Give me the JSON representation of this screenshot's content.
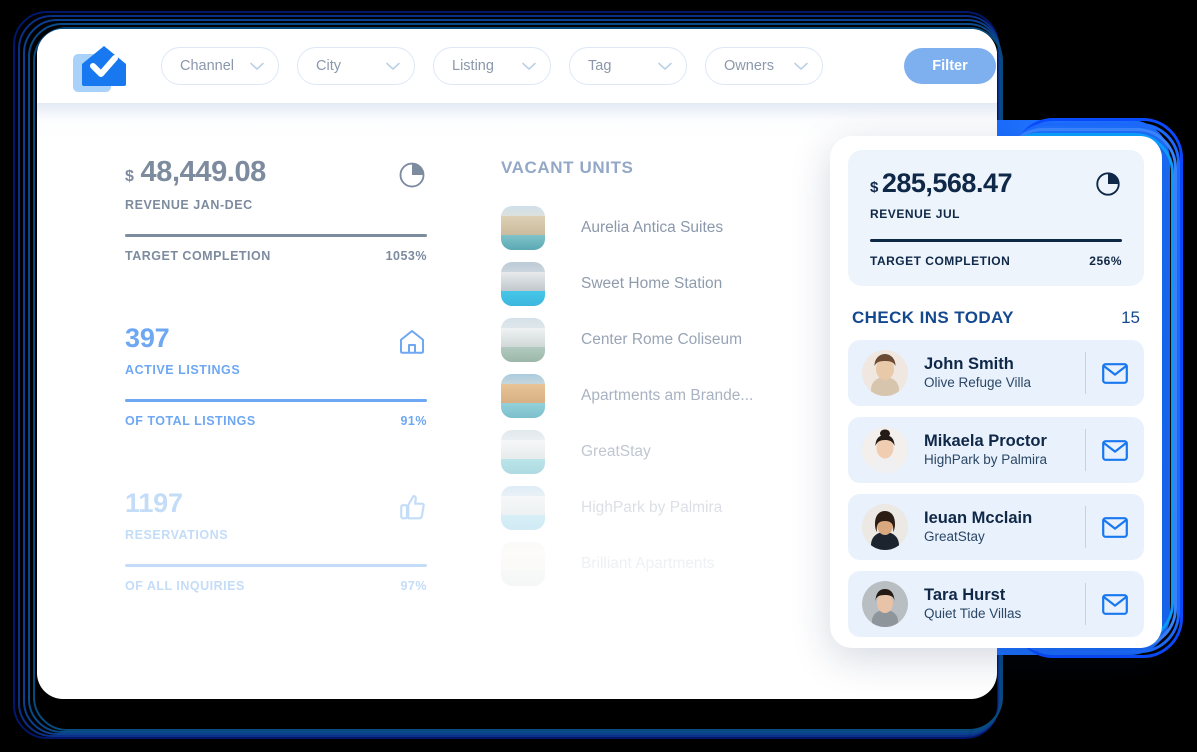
{
  "header": {
    "logo_icon": "house-check-logo",
    "filters": [
      {
        "label": "Channel",
        "icon": "chevron-down-icon"
      },
      {
        "label": "City",
        "icon": "chevron-down-icon"
      },
      {
        "label": "Listing",
        "icon": "chevron-down-icon"
      },
      {
        "label": "Tag",
        "icon": "chevron-down-icon"
      },
      {
        "label": "Owners",
        "icon": "chevron-down-icon"
      }
    ],
    "filter_button": "Filter",
    "filter_button_color": "#7eb0f0"
  },
  "stats": [
    {
      "currency": "$",
      "amount": "48,449.08",
      "caption": "REVENUE JAN-DEC",
      "foot_label": "TARGET COMPLETION",
      "foot_value": "1053%",
      "icon": "pie-chart-icon",
      "color": "#7d8b9f"
    },
    {
      "amount": "397",
      "caption": "ACTIVE LISTINGS",
      "foot_label": "OF TOTAL LISTINGS",
      "foot_value": "91%",
      "icon": "home-icon",
      "color": "#6ea7f2"
    },
    {
      "amount": "1197",
      "caption": "RESERVATIONS",
      "foot_label": "OF ALL INQUIRIES",
      "foot_value": "97%",
      "icon": "thumbs-up-icon",
      "color": "#c3dcf8"
    }
  ],
  "vacant": {
    "title": "VACANT UNITS",
    "items": [
      {
        "name": "Aurelia Antica Suites"
      },
      {
        "name": "Sweet Home Station"
      },
      {
        "name": "Center Rome Coliseum"
      },
      {
        "name": "Apartments am Brande..."
      },
      {
        "name": "GreatStay"
      },
      {
        "name": "HighPark by Palmira"
      },
      {
        "name": "Brilliant Apartments"
      }
    ]
  },
  "floating": {
    "revenue": {
      "currency": "$",
      "amount": "285,568.47",
      "caption": "REVENUE JUL",
      "foot_label": "TARGET COMPLETION",
      "foot_value": "256%",
      "icon": "pie-chart-icon",
      "accent": "#0f2847"
    },
    "checkins": {
      "title": "CHECK INS TODAY",
      "count": "15",
      "rows": [
        {
          "name": "John Smith",
          "property": "Olive Refuge Villa",
          "mail_icon": "envelope-icon"
        },
        {
          "name": "Mikaela Proctor",
          "property": "HighPark by Palmira",
          "mail_icon": "envelope-icon"
        },
        {
          "name": "Ieuan Mcclain",
          "property": "GreatStay",
          "mail_icon": "envelope-icon"
        },
        {
          "name": "Tara Hurst",
          "property": "Quiet Tide Villas",
          "mail_icon": "envelope-icon"
        }
      ]
    }
  }
}
